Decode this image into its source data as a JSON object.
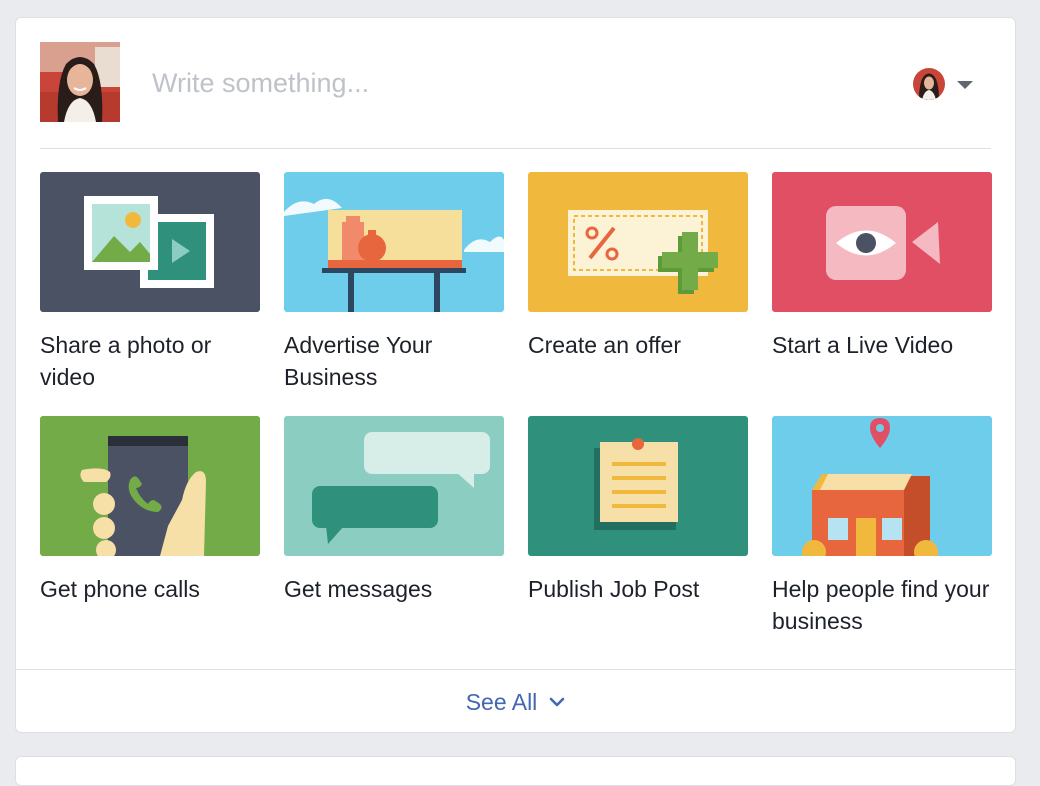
{
  "composer": {
    "placeholder": "Write something...",
    "profile_photo": "user-photo-avatar",
    "post_as_icon": "chevron-down-icon"
  },
  "actions": [
    {
      "label": "Share a photo or video",
      "icon": "photo-video-icon",
      "bg": "#4b5263"
    },
    {
      "label": "Advertise Your Business",
      "icon": "billboard-icon",
      "bg": "#6fcdec"
    },
    {
      "label": "Create an offer",
      "icon": "coupon-icon",
      "bg": "#f0b93e"
    },
    {
      "label": "Start a Live Video",
      "icon": "live-video-icon",
      "bg": "#e04f64"
    },
    {
      "label": "Get phone calls",
      "icon": "phone-call-icon",
      "bg": "#72ab47"
    },
    {
      "label": "Get messages",
      "icon": "chat-bubbles-icon",
      "bg": "#8ccdc1"
    },
    {
      "label": "Publish Job Post",
      "icon": "job-note-icon",
      "bg": "#2f917c"
    },
    {
      "label": "Help people find your business",
      "icon": "storefront-pin-icon",
      "bg": "#6fcdec"
    }
  ],
  "footer": {
    "see_all_label": "See All",
    "icon": "chevron-down-icon"
  },
  "colors": {
    "accent": "#4267b2",
    "text": "#1d2129",
    "placeholder": "#bec2c9",
    "page_bg": "#e9ebee"
  }
}
